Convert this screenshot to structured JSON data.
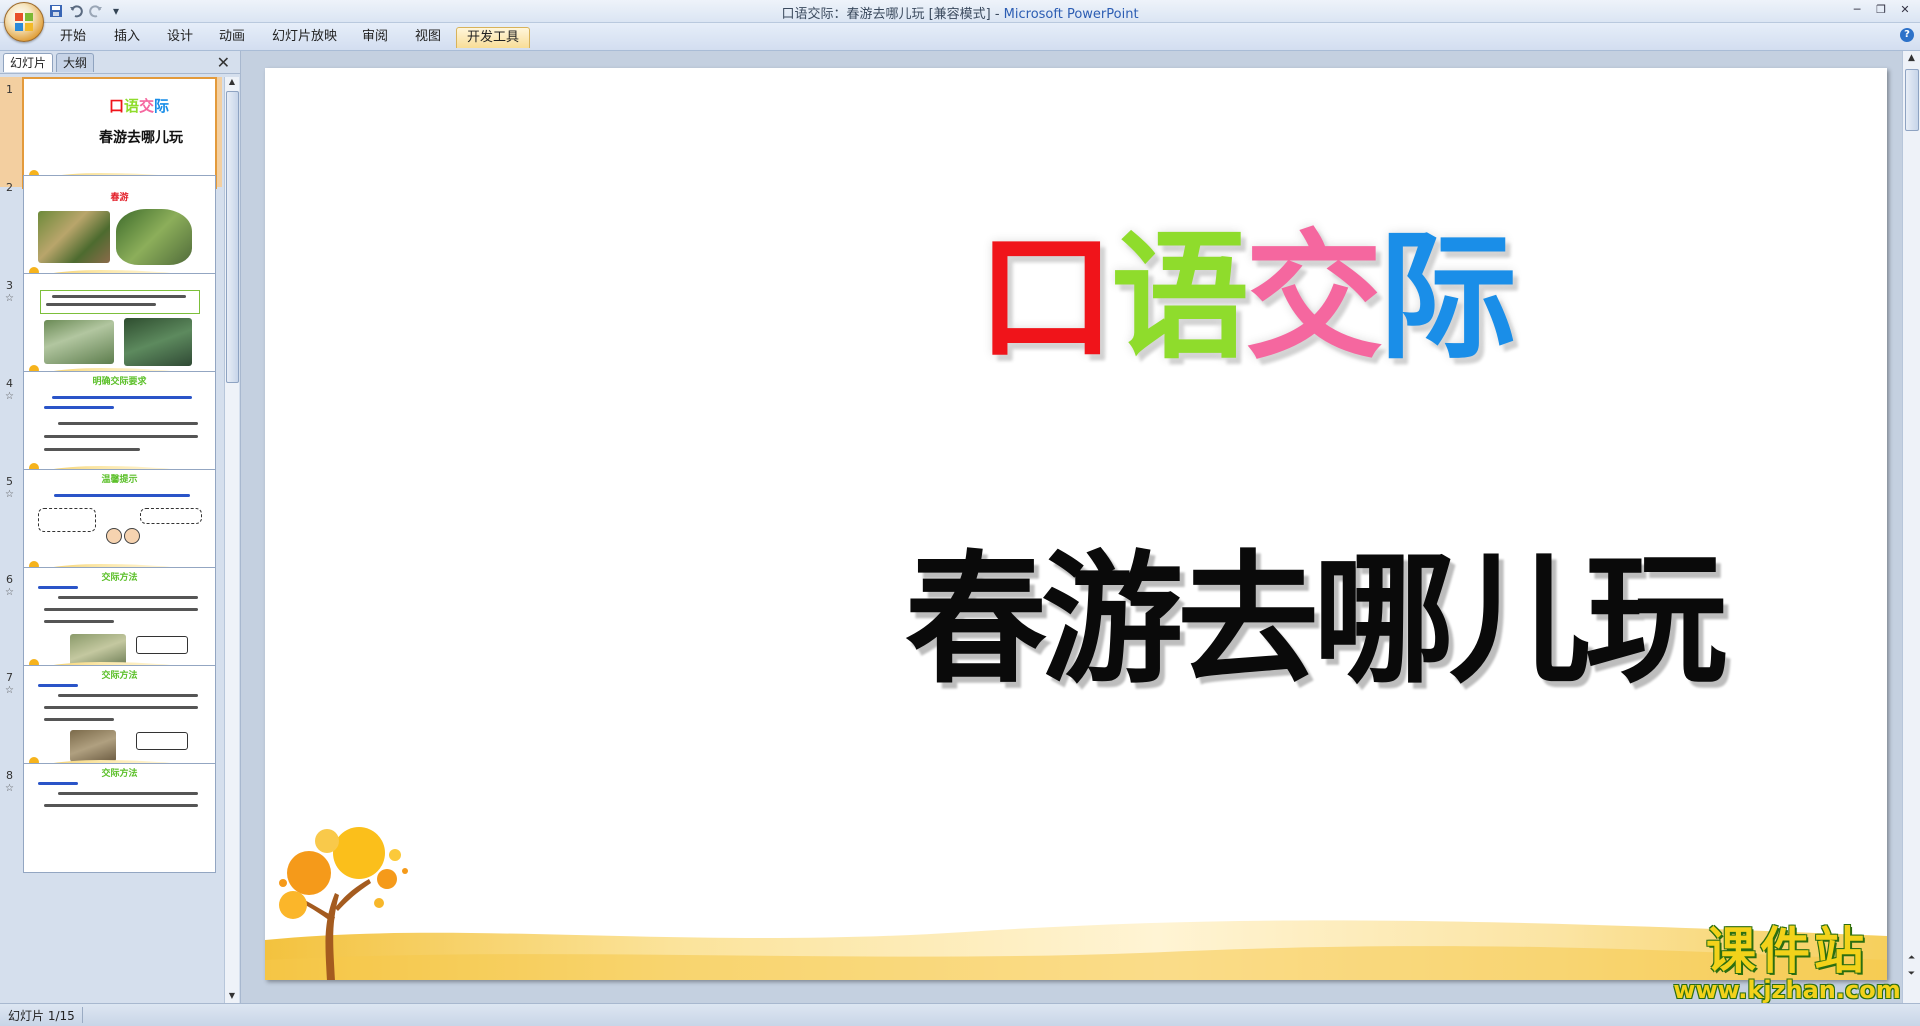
{
  "window": {
    "title": "口语交际：春游去哪儿玩 [兼容模式] - ",
    "app_name": "Microsoft PowerPoint"
  },
  "quick_access": {
    "save_icon": "save-icon",
    "undo_icon": "undo-icon",
    "redo_icon": "redo-icon",
    "customize_icon": "chevron-down-icon"
  },
  "ribbon": {
    "tabs": [
      {
        "label": "开始"
      },
      {
        "label": "插入"
      },
      {
        "label": "设计"
      },
      {
        "label": "动画"
      },
      {
        "label": "幻灯片放映"
      },
      {
        "label": "审阅"
      },
      {
        "label": "视图"
      },
      {
        "label": "开发工具",
        "active": true
      }
    ]
  },
  "left_pane": {
    "tabs": [
      {
        "label": "幻灯片",
        "active": true
      },
      {
        "label": "大纲"
      }
    ],
    "thumbnails": [
      {
        "number": "1",
        "title_colored": [
          "口",
          "语",
          "交",
          "际"
        ],
        "subtitle": "春游去哪儿玩",
        "selected": true
      },
      {
        "number": "2",
        "title": "春游"
      },
      {
        "number": "3",
        "title": ""
      },
      {
        "number": "4",
        "title": "明确交际要求"
      },
      {
        "number": "5",
        "title": "温馨提示"
      },
      {
        "number": "6",
        "title": "交际方法"
      },
      {
        "number": "7",
        "title": "交际方法"
      },
      {
        "number": "8",
        "title": "交际方法"
      }
    ]
  },
  "slide": {
    "heading_chars": [
      {
        "char": "口",
        "color": "#f0141a"
      },
      {
        "char": "语",
        "color": "#8fdc2c"
      },
      {
        "char": "交",
        "color": "#f5679f"
      },
      {
        "char": "际",
        "color": "#1a8ee8"
      }
    ],
    "subtitle": "春游去哪儿玩"
  },
  "watermark": {
    "main": "课件站",
    "url": "www.kjzhan.com"
  },
  "status_bar": {
    "slide_indicator": "幻灯片 1/15"
  },
  "colors": {
    "accent_orange": "#e39a3b",
    "ribbon_blue": "#d3def0",
    "watermark_yellow": "#f2d21a",
    "watermark_green": "#2b6e10"
  }
}
